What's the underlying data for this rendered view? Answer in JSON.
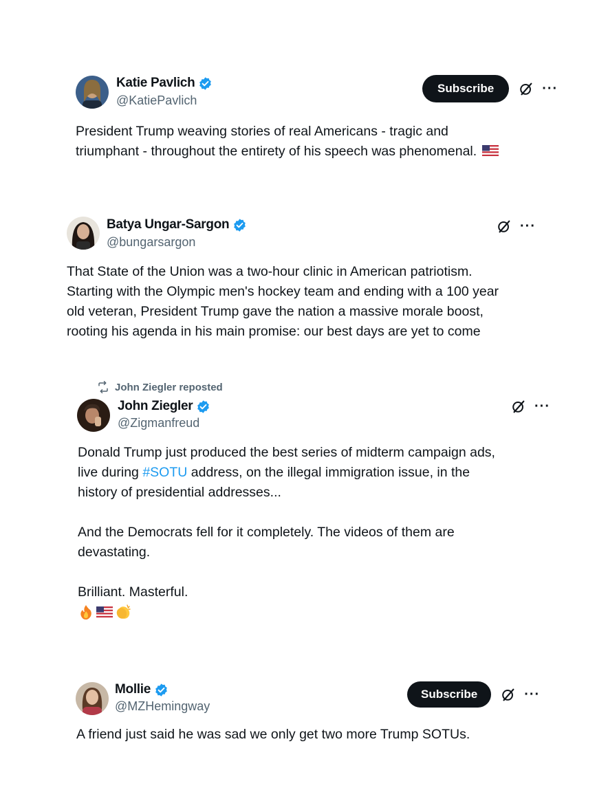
{
  "posts": [
    {
      "name": "Katie Pavlich",
      "handle": "@KatiePavlich",
      "subscribe_label": "Subscribe",
      "avatar_icon": "avatar-photo",
      "lines": [
        "President Trump weaving stories of real Americans - tragic and",
        "triumphant - throughout the entirety of his speech was phenomenal."
      ],
      "trailing_emoji": "us-flag"
    },
    {
      "name": "Batya Ungar-Sargon",
      "handle": "@bungarsargon",
      "avatar_icon": "avatar-photo",
      "lines": [
        "That State of the Union was a two-hour clinic in American patriotism.",
        "Starting with the Olympic men's hockey team and ending with a 100 year",
        "old veteran, President Trump gave the nation a massive morale boost,",
        "rooting his agenda in his main promise: our best days are yet to come"
      ]
    },
    {
      "repost_label": "John Ziegler reposted",
      "name": "John Ziegler",
      "handle": "@Zigmanfreud",
      "avatar_icon": "avatar-photo",
      "p1_lines": [
        "Donald Trump just produced the best series of midterm campaign ads,",
        "address, on the illegal immigration issue, in the",
        "history of presidential addresses..."
      ],
      "p1_line2_prefix": "live during ",
      "hashtag": "#SOTU",
      "p2_lines": [
        "And the Democrats fell for it completely. The videos of them are",
        "devastating."
      ],
      "p3_line": "Brilliant. Masterful.",
      "emojis": [
        "fire",
        "us-flag",
        "clapping-hands"
      ]
    },
    {
      "name": "Mollie",
      "handle": "@MZHemingway",
      "subscribe_label": "Subscribe",
      "avatar_icon": "avatar-photo",
      "lines": [
        "A friend just said he was sad we only get two more Trump SOTUs."
      ]
    }
  ],
  "icons": {
    "verified": "verified-badge-icon",
    "grok": "grok-icon",
    "more": "more-icon",
    "repost": "repost-icon"
  },
  "colors": {
    "text": "#0f1419",
    "secondary": "#536471",
    "verified": "#1d9bf0",
    "hashtag": "#1d9bf0",
    "button": "#0f1419"
  }
}
